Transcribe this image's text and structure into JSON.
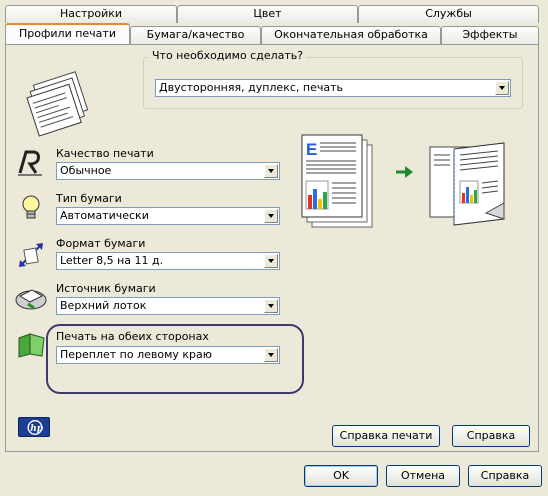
{
  "tabs": {
    "row_back": [
      "Настройки",
      "Цвет",
      "Службы"
    ],
    "row_front": [
      "Профили печати",
      "Бумага/качество",
      "Окончательная обработка",
      "Эффекты"
    ]
  },
  "task": {
    "group_title": "Что необходимо сделать?",
    "selected": "Двусторонняя, дуплекс, печать"
  },
  "settings": [
    {
      "label": "Качество печати",
      "value": "Обычное",
      "icon": "print-quality-icon"
    },
    {
      "label": "Тип бумаги",
      "value": "Автоматически",
      "icon": "lightbulb-icon"
    },
    {
      "label": "Формат бумаги",
      "value": "Letter 8,5 на 11 д.",
      "icon": "paper-size-icon"
    },
    {
      "label": "Источник бумаги",
      "value": "Верхний лоток",
      "icon": "paper-tray-icon"
    },
    {
      "label": "Печать на обеих сторонах",
      "value": "Переплет по левому краю",
      "icon": "duplex-icon"
    }
  ],
  "buttons": {
    "print_help": "Справка печати",
    "help_inner": "Справка",
    "ok": "OK",
    "cancel": "Отмена",
    "help": "Справка"
  },
  "colors": {
    "window_bg": "#ece9d8",
    "tab_accent": "#e68b2c",
    "highlight_border": "#3a3a6e",
    "hp_logo_blue": "#1c3f94"
  }
}
